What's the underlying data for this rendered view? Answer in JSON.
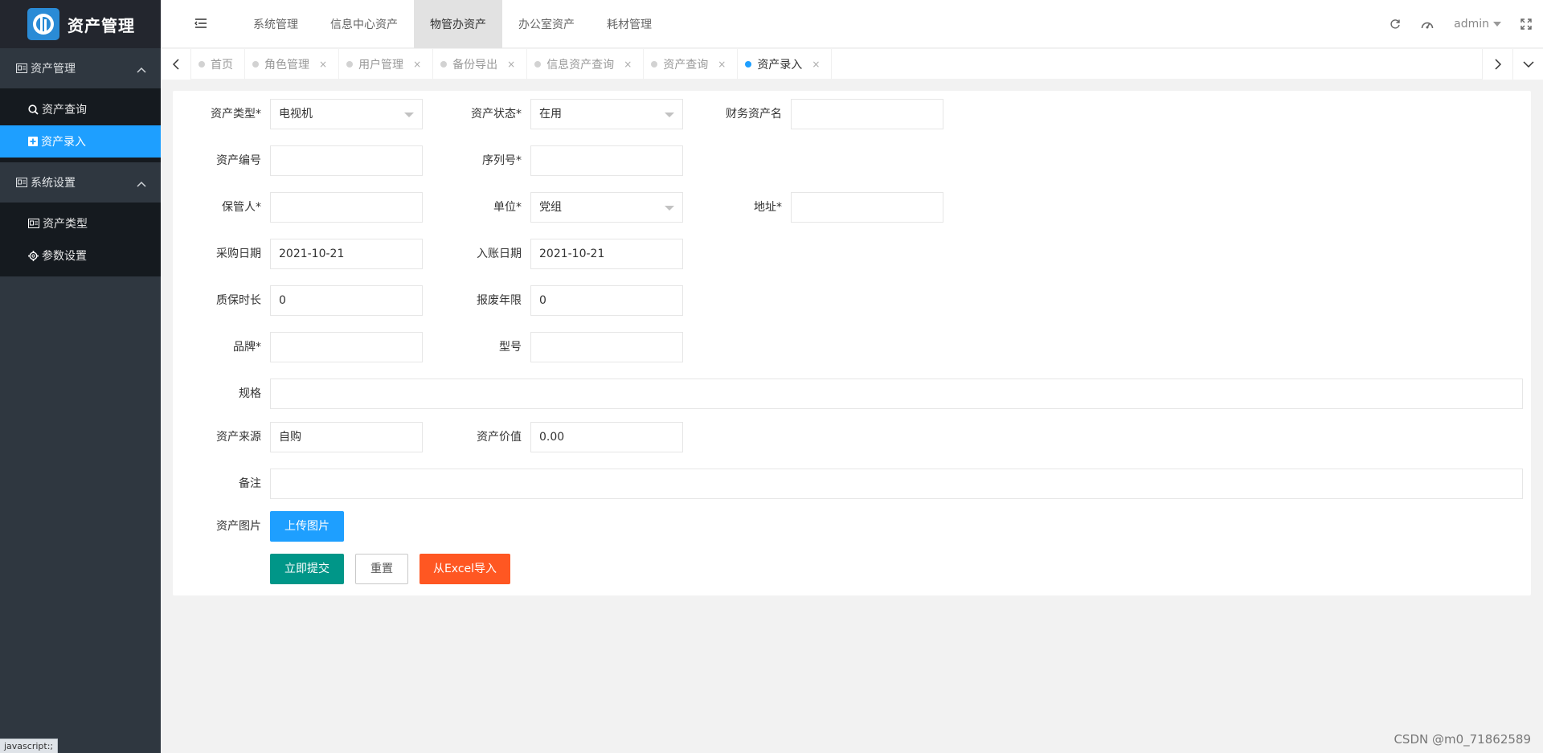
{
  "app": {
    "title": "资产管理"
  },
  "sidebar": {
    "groups": [
      {
        "label": "资产管理",
        "items": [
          {
            "label": "资产查询"
          },
          {
            "label": "资产录入"
          }
        ]
      },
      {
        "label": "系统设置",
        "items": [
          {
            "label": "资产类型"
          },
          {
            "label": "参数设置"
          }
        ]
      }
    ],
    "status_text": "javascript:;"
  },
  "topnav": {
    "items": [
      "系统管理",
      "信息中心资产",
      "物管办资产",
      "办公室资产",
      "耗材管理"
    ],
    "active": "物管办资产",
    "user": "admin"
  },
  "tabs": {
    "items": [
      "首页",
      "角色管理",
      "用户管理",
      "备份导出",
      "信息资产查询",
      "资产查询",
      "资产录入"
    ],
    "active": "资产录入",
    "close": "×"
  },
  "form": {
    "asset_type": {
      "label": "资产类型*",
      "value": "电视机"
    },
    "asset_status": {
      "label": "资产状态*",
      "value": "在用"
    },
    "finance_name": {
      "label": "财务资产名",
      "value": ""
    },
    "asset_no": {
      "label": "资产编号",
      "value": ""
    },
    "serial_no": {
      "label": "序列号*",
      "value": ""
    },
    "keeper": {
      "label": "保管人*",
      "value": ""
    },
    "unit": {
      "label": "单位*",
      "value": "党组"
    },
    "address": {
      "label": "地址*",
      "value": ""
    },
    "purchase_date": {
      "label": "采购日期",
      "value": "2021-10-21"
    },
    "booking_date": {
      "label": "入账日期",
      "value": "2021-10-21"
    },
    "warranty": {
      "label": "质保时长",
      "value": "0"
    },
    "scrap_years": {
      "label": "报废年限",
      "value": "0"
    },
    "brand": {
      "label": "品牌*",
      "value": ""
    },
    "model": {
      "label": "型号",
      "value": ""
    },
    "spec": {
      "label": "规格",
      "value": ""
    },
    "source": {
      "label": "资产来源",
      "value": "自购"
    },
    "value": {
      "label": "资产价值",
      "value": "0.00"
    },
    "remark": {
      "label": "备注",
      "value": ""
    },
    "image": {
      "label": "资产图片"
    }
  },
  "buttons": {
    "upload": "上传图片",
    "submit": "立即提交",
    "reset": "重置",
    "import_excel": "从Excel导入"
  },
  "watermark": "CSDN @m0_71862589",
  "colors": {
    "accent": "#1e9fff",
    "submit": "#009688",
    "import": "#ff5722",
    "sidebar": "#2f3740",
    "submenu": "#151a1f"
  }
}
